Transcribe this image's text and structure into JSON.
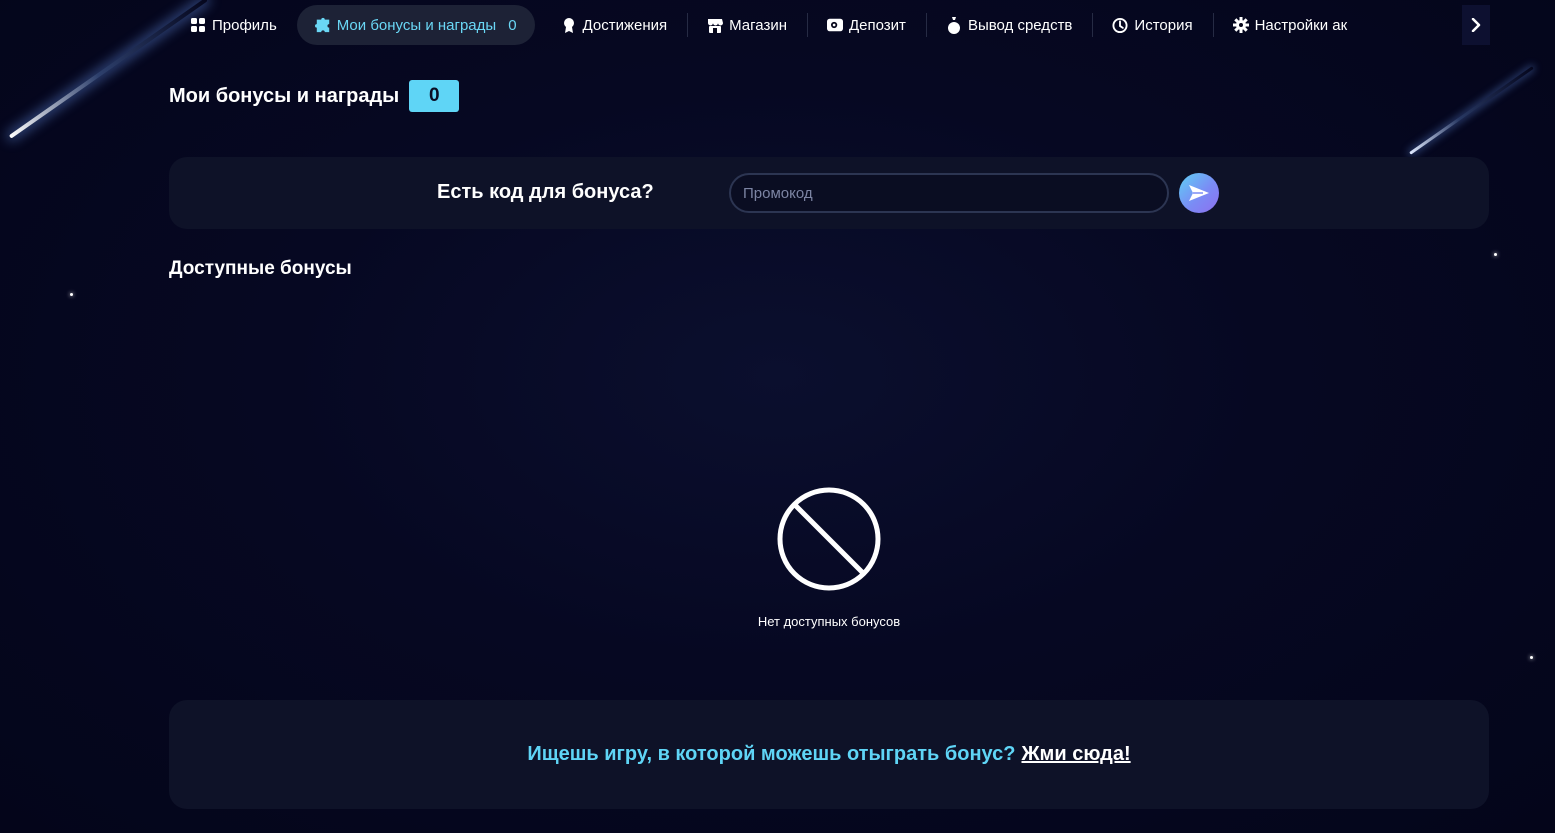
{
  "nav": {
    "items": [
      {
        "label": "Профиль",
        "icon": "grid-icon"
      },
      {
        "label": "Мои бонусы и награды",
        "icon": "puzzle-icon",
        "count": "0",
        "active": true
      },
      {
        "label": "Достижения",
        "icon": "medal-icon"
      },
      {
        "label": "Магазин",
        "icon": "store-icon"
      },
      {
        "label": "Депозит",
        "icon": "wallet-icon"
      },
      {
        "label": "Вывод средств",
        "icon": "money-bag-icon"
      },
      {
        "label": "История",
        "icon": "clock-icon"
      },
      {
        "label": "Настройки ак",
        "icon": "gear-icon"
      }
    ],
    "accent_color": "#6ad7f5"
  },
  "header": {
    "title": "Мои бонусы и награды",
    "count": "0"
  },
  "promo": {
    "label": "Есть код для бонуса?",
    "input_placeholder": "Промокод",
    "input_value": ""
  },
  "available": {
    "title": "Доступные бонусы",
    "empty_text": "Нет доступных бонусов"
  },
  "cta": {
    "text": "Ищешь игру, в которой можешь отыграть бонус?",
    "link": "Жми сюда!"
  },
  "colors": {
    "background": "#05061a",
    "card": "#0e1228",
    "accent": "#5fd5f6"
  }
}
